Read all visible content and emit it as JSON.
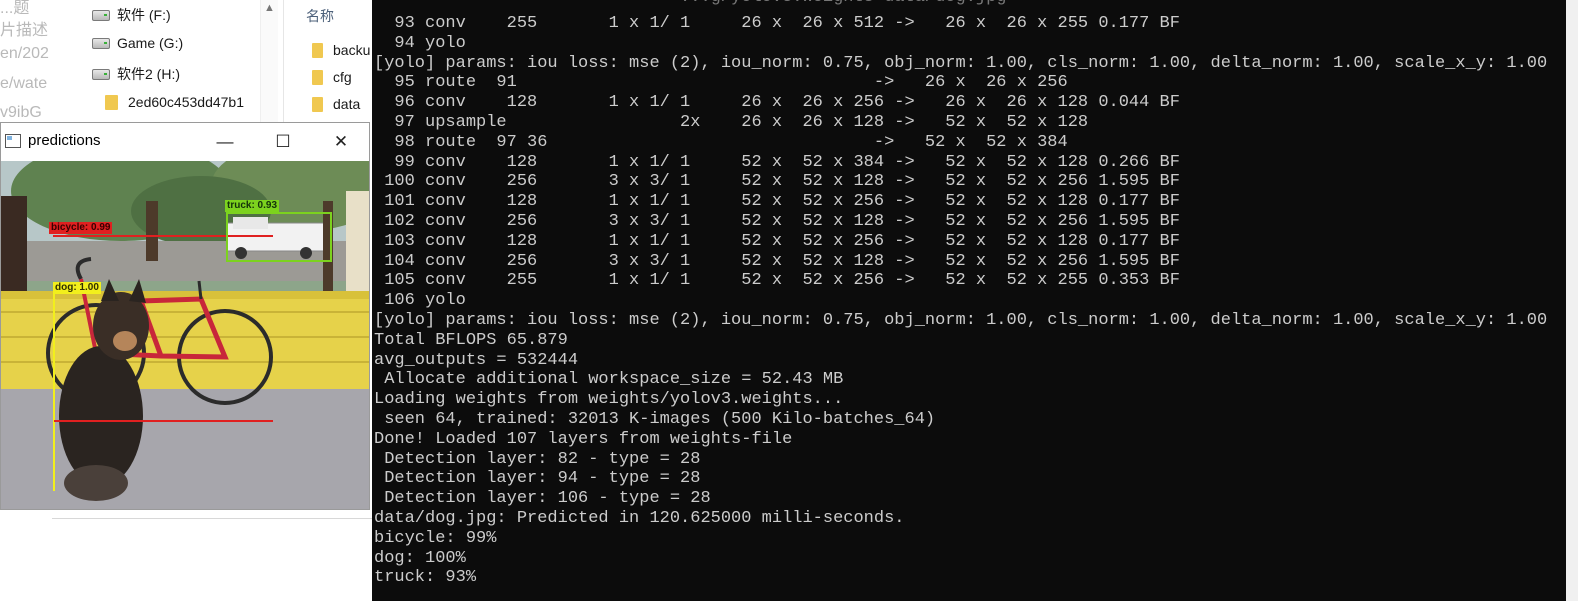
{
  "browser_fragments": [
    "...题",
    "片描述",
    "en/202",
    "e/wate",
    "v9ibG"
  ],
  "explorer": {
    "nav_items": [
      {
        "label": "软件 (F:)",
        "icon": "drive-icon"
      },
      {
        "label": "Game (G:)",
        "icon": "drive-icon"
      },
      {
        "label": "软件2 (H:)",
        "icon": "drive-icon"
      },
      {
        "label": "2ed60c453dd47b1",
        "icon": "folder-icon"
      }
    ],
    "column_header": "名称",
    "files": [
      {
        "label": "backu"
      },
      {
        "label": "cfg"
      },
      {
        "label": "data"
      }
    ]
  },
  "predictions_window": {
    "title": "predictions",
    "minimize": "—",
    "maximize": "☐",
    "close": "✕",
    "detections": [
      {
        "label": "bicycle: 0.99",
        "color": "#e02020"
      },
      {
        "label": "truck: 0.93",
        "color": "#7cd21e"
      },
      {
        "label": "dog: 1.00",
        "color": "#f2ef1c"
      }
    ]
  },
  "console": {
    "top_fragment": "                              ...g/yolov3.weights data/dog.jpg",
    "lines": [
      "  93 conv    255       1 x 1/ 1     26 x  26 x 512 ->   26 x  26 x 255 0.177 BF",
      "  94 yolo",
      "[yolo] params: iou loss: mse (2), iou_norm: 0.75, obj_norm: 1.00, cls_norm: 1.00, delta_norm: 1.00, scale_x_y: 1.00",
      "  95 route  91                                   ->   26 x  26 x 256",
      "  96 conv    128       1 x 1/ 1     26 x  26 x 256 ->   26 x  26 x 128 0.044 BF",
      "  97 upsample                 2x    26 x  26 x 128 ->   52 x  52 x 128",
      "  98 route  97 36                                ->   52 x  52 x 384",
      "  99 conv    128       1 x 1/ 1     52 x  52 x 384 ->   52 x  52 x 128 0.266 BF",
      " 100 conv    256       3 x 3/ 1     52 x  52 x 128 ->   52 x  52 x 256 1.595 BF",
      " 101 conv    128       1 x 1/ 1     52 x  52 x 256 ->   52 x  52 x 128 0.177 BF",
      " 102 conv    256       3 x 3/ 1     52 x  52 x 128 ->   52 x  52 x 256 1.595 BF",
      " 103 conv    128       1 x 1/ 1     52 x  52 x 256 ->   52 x  52 x 128 0.177 BF",
      " 104 conv    256       3 x 3/ 1     52 x  52 x 128 ->   52 x  52 x 256 1.595 BF",
      " 105 conv    255       1 x 1/ 1     52 x  52 x 256 ->   52 x  52 x 255 0.353 BF",
      " 106 yolo",
      "[yolo] params: iou loss: mse (2), iou_norm: 0.75, obj_norm: 1.00, cls_norm: 1.00, delta_norm: 1.00, scale_x_y: 1.00",
      "Total BFLOPS 65.879",
      "avg_outputs = 532444",
      " Allocate additional workspace_size = 52.43 MB",
      "Loading weights from weights/yolov3.weights...",
      " seen 64, trained: 32013 K-images (500 Kilo-batches_64)",
      "Done! Loaded 107 layers from weights-file",
      " Detection layer: 82 - type = 28",
      " Detection layer: 94 - type = 28",
      " Detection layer: 106 - type = 28",
      "data/dog.jpg: Predicted in 120.625000 milli-seconds.",
      "bicycle: 99%",
      "dog: 100%",
      "truck: 93%"
    ]
  }
}
